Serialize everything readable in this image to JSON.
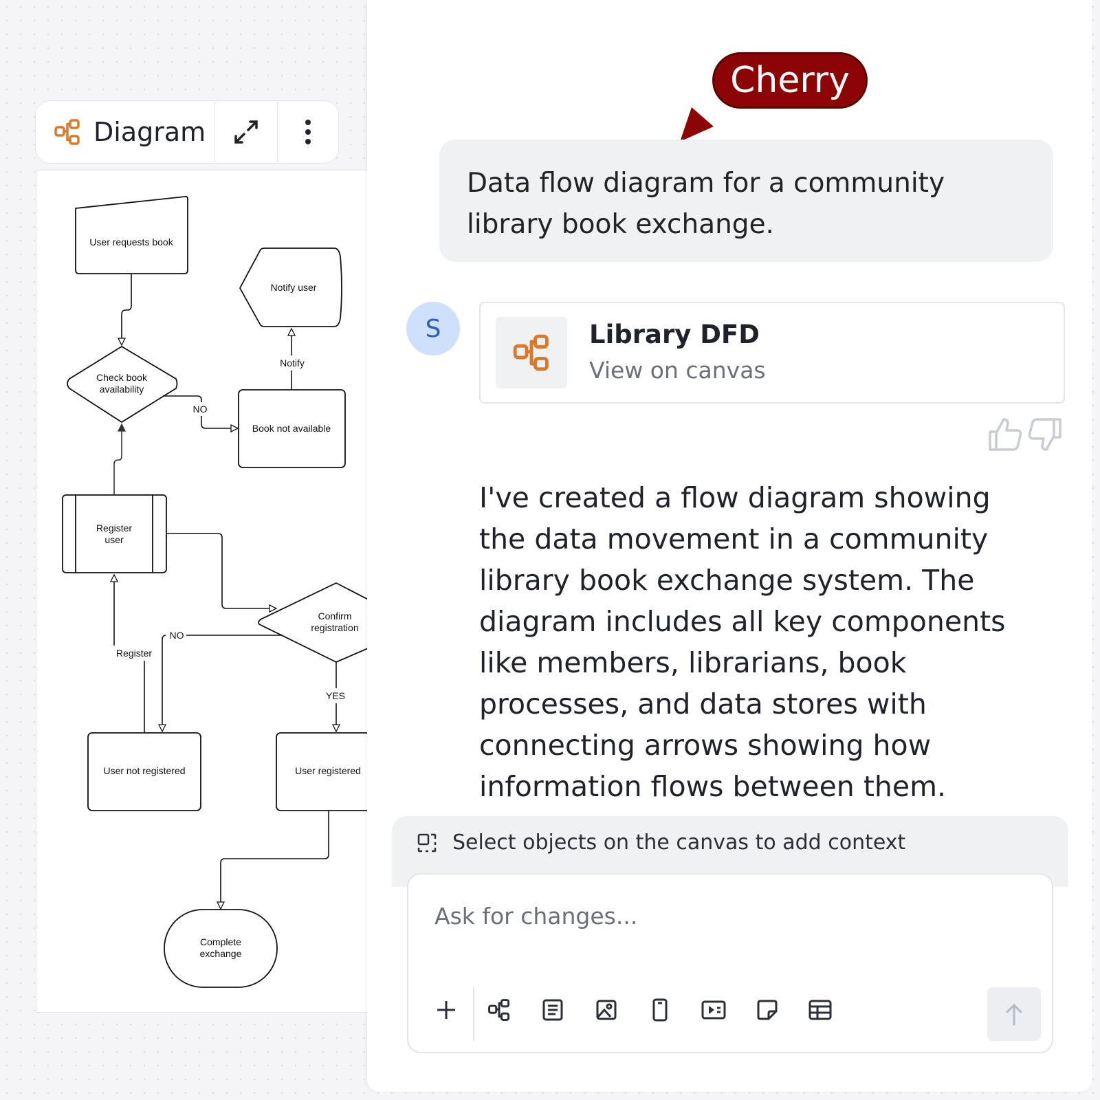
{
  "canvas": {
    "toolbar": {
      "title": "Diagram",
      "icons": {
        "diagram": "diagram-icon",
        "expand": "expand-icon",
        "more": "more-vertical-icon"
      }
    },
    "diagram": {
      "nodes": {
        "user_requests_book": "User requests book",
        "notify_user": "Notify user",
        "check_book_l1": "Check book",
        "check_book_l2": "availability",
        "book_not_available": "Book not available",
        "register_user_l1": "Register",
        "register_user_l2": "user",
        "confirm_l1": "Confirm",
        "confirm_l2": "registration",
        "user_not_registered": "User not registered",
        "user_registered": "User registered",
        "complete_l1": "Complete",
        "complete_l2": "exchange"
      },
      "edges": {
        "no_1": "NO",
        "notify": "Notify",
        "no_2": "NO",
        "register": "Register",
        "yes": "YES"
      }
    }
  },
  "cursor_label": "Cherry",
  "chat": {
    "user_message": "Data flow diagram for a community library book exchange.",
    "assistant_avatar": "S",
    "artifact": {
      "title": "Library DFD",
      "link": "View on canvas",
      "icon": "diagram-icon"
    },
    "response": "I've created a flow diagram showing the data movement in a community library book exchange system. The diagram includes all key components like members, librarians, book processes, and data stores with connecting arrows showing how information flows between them.",
    "feedback_icons": [
      "thumbs-up-icon",
      "thumbs-down-icon"
    ]
  },
  "composer": {
    "context_hint": "Select objects on the canvas to add context",
    "placeholder": "Ask for changes...",
    "tools": [
      "plus-icon",
      "diagram-icon",
      "document-icon",
      "image-icon",
      "mobile-icon",
      "slides-icon",
      "sticky-note-icon",
      "table-icon"
    ],
    "send_icon": "arrow-up-icon"
  },
  "colors": {
    "accent": "#d97a2b",
    "cherry": "#8c0505",
    "avatar_bg": "#cfe0fb",
    "avatar_text": "#2e5fb4"
  }
}
